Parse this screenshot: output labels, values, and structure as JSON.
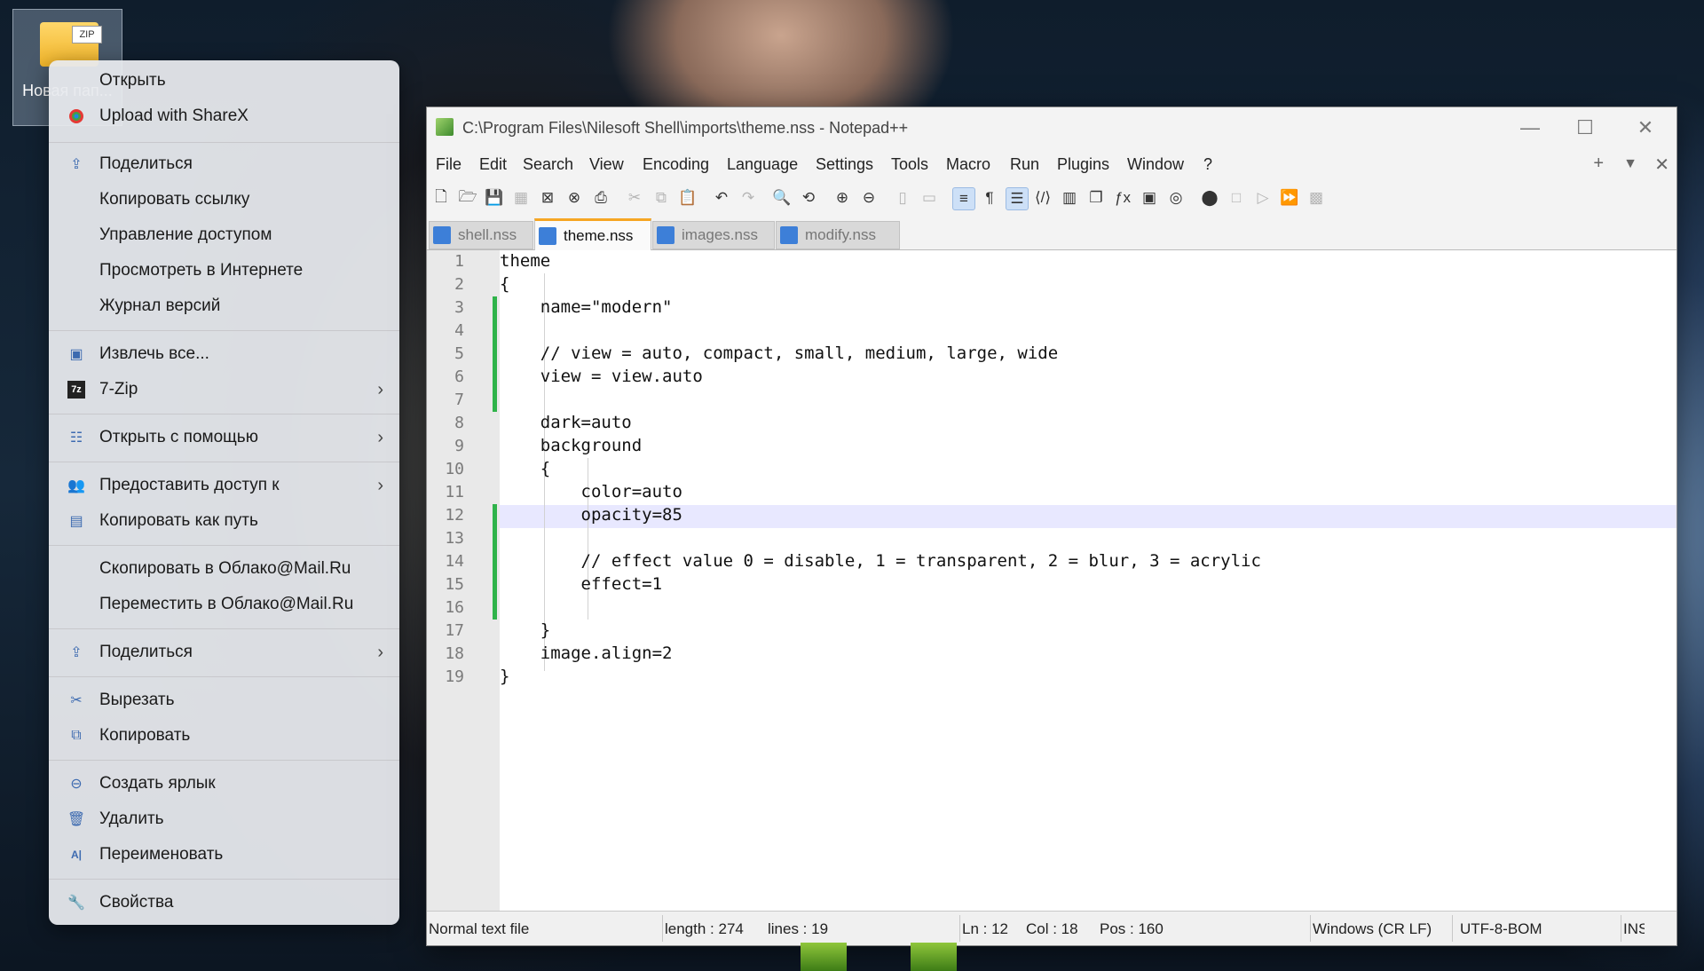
{
  "desktop_icon": {
    "badge": "ZIP",
    "label": "Новая пап..."
  },
  "context_menu": {
    "items": [
      {
        "label": "Открыть",
        "icon": "none",
        "submenu": false
      },
      {
        "label": "Upload with ShareX",
        "icon": "sharex-icon",
        "submenu": false
      },
      {
        "label": "Поделиться",
        "icon": "share-icon",
        "submenu": false
      },
      {
        "label": "Копировать ссылку",
        "icon": "none",
        "submenu": false
      },
      {
        "label": "Управление доступом",
        "icon": "none",
        "submenu": false
      },
      {
        "label": "Просмотреть в Интернете",
        "icon": "none",
        "submenu": false
      },
      {
        "label": "Журнал версий",
        "icon": "none",
        "submenu": false
      },
      {
        "label": "Извлечь все...",
        "icon": "extract-icon",
        "submenu": false
      },
      {
        "label": "7-Zip",
        "icon": "7zip-icon",
        "submenu": true
      },
      {
        "label": "Открыть с помощью",
        "icon": "open-with-icon",
        "submenu": true
      },
      {
        "label": "Предоставить доступ к",
        "icon": "share-access-icon",
        "submenu": true
      },
      {
        "label": "Копировать как путь",
        "icon": "copy-path-icon",
        "submenu": false
      },
      {
        "label": "Скопировать в Облако@Mail.Ru",
        "icon": "none",
        "submenu": false
      },
      {
        "label": "Переместить в Облако@Mail.Ru",
        "icon": "none",
        "submenu": false
      },
      {
        "label": "Поделиться",
        "icon": "share-icon",
        "submenu": true
      },
      {
        "label": "Вырезать",
        "icon": "scissors-icon",
        "submenu": false
      },
      {
        "label": "Копировать",
        "icon": "copy-icon",
        "submenu": false
      },
      {
        "label": "Создать ярлык",
        "icon": "shortcut-icon",
        "submenu": false
      },
      {
        "label": "Удалить",
        "icon": "trash-icon",
        "submenu": false
      },
      {
        "label": "Переименовать",
        "icon": "rename-icon",
        "submenu": false
      },
      {
        "label": "Свойства",
        "icon": "wrench-icon",
        "submenu": false
      }
    ]
  },
  "window": {
    "title": "C:\\Program Files\\Nilesoft Shell\\imports\\theme.nss - Notepad++",
    "menu": [
      "File",
      "Edit",
      "Search",
      "View",
      "Encoding",
      "Language",
      "Settings",
      "Tools",
      "Macro",
      "Run",
      "Plugins",
      "Window",
      "?"
    ],
    "tabs": [
      {
        "name": "shell.nss",
        "active": false
      },
      {
        "name": "theme.nss",
        "active": true
      },
      {
        "name": "images.nss",
        "active": false
      },
      {
        "name": "modify.nss",
        "active": false
      }
    ],
    "current_line": 12,
    "lines": [
      "theme",
      "{",
      "    name=\"modern\"",
      "",
      "    // view = auto, compact, small, medium, large, wide",
      "    view = view.auto",
      "",
      "    dark=auto",
      "    background",
      "    {",
      "        color=auto",
      "        opacity=85",
      "",
      "        // effect value 0 = disable, 1 = transparent, 2 = blur, 3 = acrylic",
      "        effect=1",
      "",
      "    }",
      "    image.align=2",
      "}"
    ],
    "status": {
      "file_type": "Normal text file",
      "length": "length : 274",
      "lines": "lines : 19",
      "ln": "Ln : 12",
      "col": "Col : 18",
      "pos": "Pos : 160",
      "eol": "Windows (CR LF)",
      "encoding": "UTF-8-BOM",
      "mode": "INS"
    },
    "accent": "#f6a623",
    "change_marker_color": "#2fb34a"
  }
}
